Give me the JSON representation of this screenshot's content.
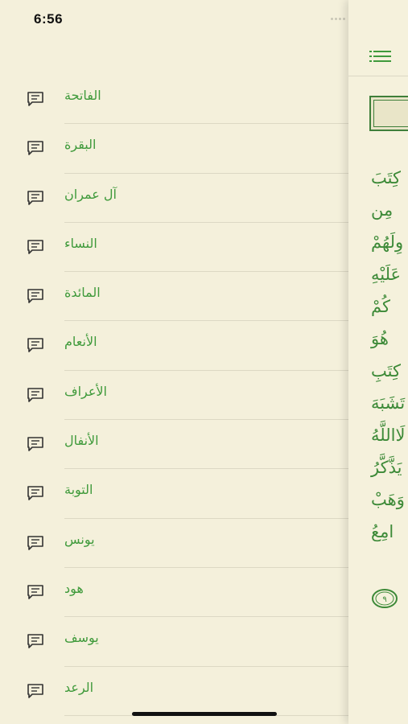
{
  "status_bar": {
    "time": "6:56"
  },
  "side_menu": {
    "surahs": [
      "الفاتحة",
      "البقرة",
      "آل عمران",
      "النساء",
      "المائدة",
      "الأنعام",
      "الأعراف",
      "الأنفال",
      "التوبة",
      "يونس",
      "هود",
      "يوسف",
      "الرعد"
    ]
  },
  "main": {
    "verse_fragments": [
      "كِتَبَ",
      "مِن",
      "وِلَهُمْ",
      "عَلَيْهِ",
      "كُمْ",
      "هُوَ",
      "كِتَبِ",
      "تَشَبَهَ",
      "لَااللَّهُ",
      "يَذَّكَّرُ",
      "وَهَبْ",
      "امِعُ"
    ],
    "ayah_number": "٩"
  },
  "colors": {
    "accent": "#3F9A3B",
    "background": "#F4F0DB"
  },
  "icons": {
    "row_icon": "chat-bubble-icon",
    "menu": "list-menu-icon"
  }
}
